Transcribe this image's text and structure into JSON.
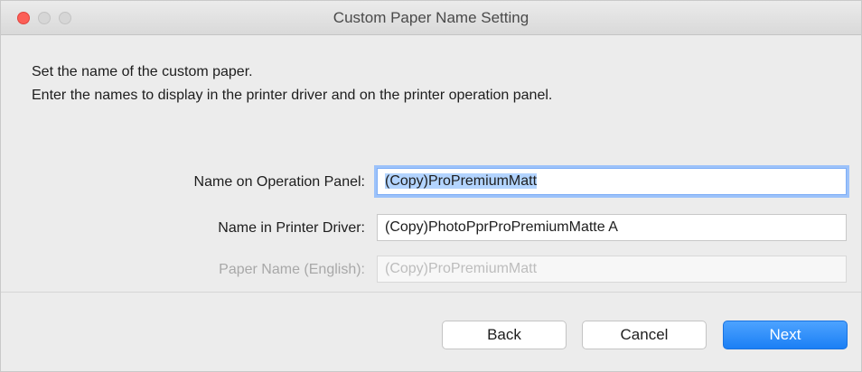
{
  "window": {
    "title": "Custom Paper Name Setting"
  },
  "instructions": {
    "line1": "Set the name of the custom paper.",
    "line2": "Enter the names to display in the printer driver and on the printer operation panel."
  },
  "fields": [
    {
      "label": "Name on Operation Panel:",
      "value": "(Copy)ProPremiumMatt",
      "state": "focused-selected"
    },
    {
      "label": "Name in Printer Driver:",
      "value": "(Copy)PhotoPprProPremiumMatte A",
      "state": "normal"
    },
    {
      "label": "Paper Name (English):",
      "value": "(Copy)ProPremiumMatt",
      "state": "disabled"
    }
  ],
  "buttons": {
    "back": "Back",
    "cancel": "Cancel",
    "next": "Next"
  },
  "colors": {
    "accent": "#1b7ff5",
    "close_light": "#fc5f57",
    "focus_ring": "#9cc2fa"
  }
}
